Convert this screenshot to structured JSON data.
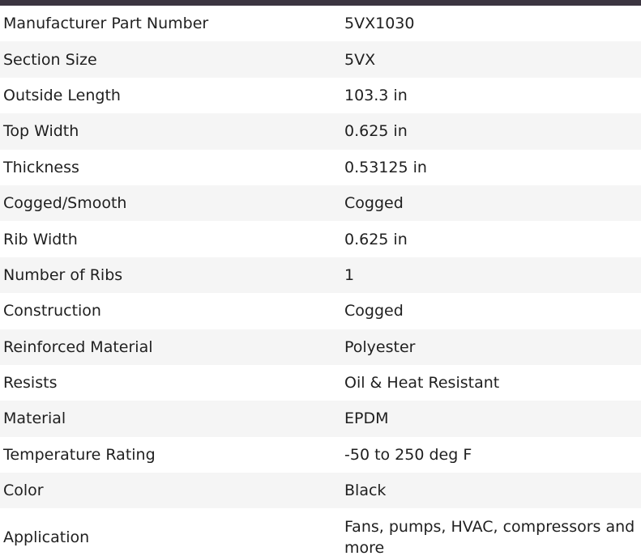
{
  "colors": {
    "top_bar": "#3b3540",
    "text": "#1f1f1f",
    "row_alt": "#f5f5f5"
  },
  "specs": [
    {
      "label": "Manufacturer Part Number",
      "value": "5VX1030"
    },
    {
      "label": "Section Size",
      "value": "5VX"
    },
    {
      "label": "Outside Length",
      "value": "103.3 in"
    },
    {
      "label": "Top Width",
      "value": "0.625 in"
    },
    {
      "label": "Thickness",
      "value": "0.53125 in"
    },
    {
      "label": "Cogged/Smooth",
      "value": "Cogged"
    },
    {
      "label": "Rib Width",
      "value": "0.625 in"
    },
    {
      "label": "Number of Ribs",
      "value": "1"
    },
    {
      "label": "Construction",
      "value": "Cogged"
    },
    {
      "label": "Reinforced Material",
      "value": "Polyester"
    },
    {
      "label": "Resists",
      "value": "Oil & Heat Resistant"
    },
    {
      "label": "Material",
      "value": "EPDM"
    },
    {
      "label": "Temperature Rating",
      "value": "-50 to 250 deg F"
    },
    {
      "label": "Color",
      "value": "Black"
    },
    {
      "label": "Application",
      "value": "Fans, pumps, HVAC, compressors and more"
    }
  ]
}
